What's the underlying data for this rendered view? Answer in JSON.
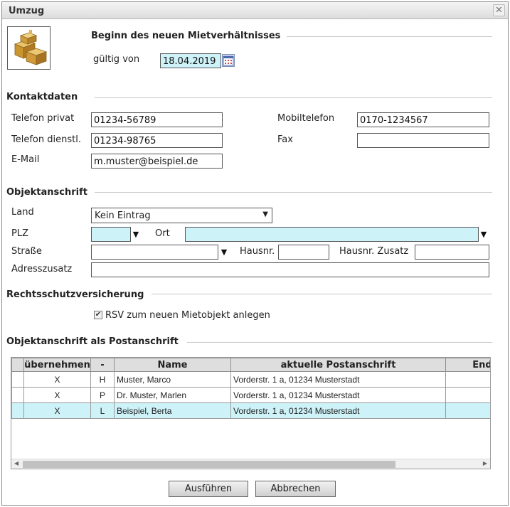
{
  "dialog": {
    "title": "Umzug",
    "close_symbol": "✕"
  },
  "beginn": {
    "heading": "Beginn des neuen Mietverhältnisses",
    "gueltig_label": "gültig von",
    "gueltig_value": "18.04.2019"
  },
  "kontakt": {
    "heading": "Kontaktdaten",
    "telefon_privat_label": "Telefon privat",
    "telefon_privat_value": "01234-56789",
    "mobil_label": "Mobiltelefon",
    "mobil_value": "0170-1234567",
    "telefon_dienst_label": "Telefon dienstl.",
    "telefon_dienst_value": "01234-98765",
    "fax_label": "Fax",
    "fax_value": "",
    "email_label": "E-Mail",
    "email_value": "m.muster@beispiel.de"
  },
  "objekt": {
    "heading": "Objektanschrift",
    "land_label": "Land",
    "land_value": "Kein Eintrag",
    "plz_label": "PLZ",
    "plz_value": "",
    "ort_label": "Ort",
    "ort_value": "",
    "strasse_label": "Straße",
    "strasse_value": "",
    "hausnr_label": "Hausnr.",
    "hausnr_value": "",
    "hausnr_zusatz_label": "Hausnr. Zusatz",
    "hausnr_zusatz_value": "",
    "adresszusatz_label": "Adresszusatz",
    "adresszusatz_value": ""
  },
  "rsv": {
    "heading": "Rechtsschutzversicherung",
    "checkbox_label": "RSV zum neuen Mietobjekt anlegen",
    "checked": true,
    "check_symbol": "✔"
  },
  "postanschrift": {
    "heading": "Objektanschrift als Postanschrift",
    "columns": [
      "",
      "übernehmen",
      "-",
      "Name",
      "aktuelle Postanschrift",
      "Enddatum"
    ],
    "rows": [
      {
        "uebernehmen": "X",
        "typ": "H",
        "name": "Muster, Marco",
        "anschrift": "Vorderstr. 1 a, 01234 Musterstadt",
        "enddatum": ""
      },
      {
        "uebernehmen": "X",
        "typ": "P",
        "name": "Dr. Muster, Marlen",
        "anschrift": "Vorderstr. 1 a, 01234 Musterstadt",
        "enddatum": ""
      },
      {
        "uebernehmen": "X",
        "typ": "L",
        "name": "Beispiel, Berta",
        "anschrift": "Vorderstr. 1 a, 01234 Musterstadt",
        "enddatum": ""
      }
    ],
    "selected_row": 2
  },
  "buttons": {
    "ausfuehren": "Ausführen",
    "abbrechen": "Abbrechen"
  },
  "colors": {
    "highlight": "#cdf2f8",
    "header_bg": "#dedede"
  }
}
